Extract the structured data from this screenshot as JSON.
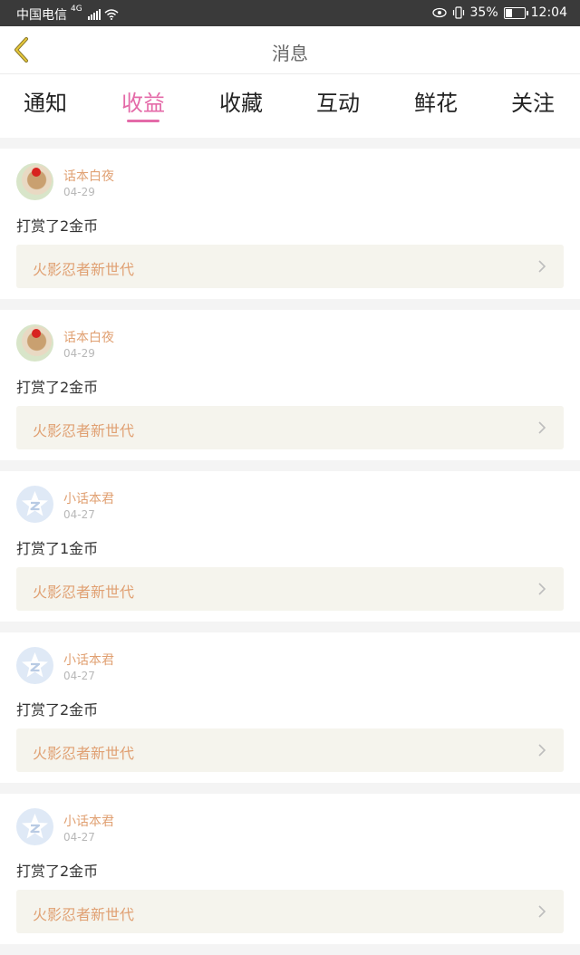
{
  "status_bar": {
    "carrier": "中国电信",
    "network": "4G",
    "battery_percent": "35%",
    "time": "12:04"
  },
  "header": {
    "title": "消息",
    "back_icon": "chevron-left-icon"
  },
  "tabs": [
    {
      "label": "通知",
      "active": false
    },
    {
      "label": "收益",
      "active": true
    },
    {
      "label": "收藏",
      "active": false
    },
    {
      "label": "互动",
      "active": false
    },
    {
      "label": "鲜花",
      "active": false
    },
    {
      "label": "关注",
      "active": false
    }
  ],
  "colors": {
    "accent": "#e46aa8",
    "username": "#e0a072",
    "link_bg": "#f5f4ed"
  },
  "feed": [
    {
      "user": "话本白夜",
      "date": "04-29",
      "message": "打赏了2金币",
      "link": "火影忍者新世代",
      "avatar": "photo"
    },
    {
      "user": "话本白夜",
      "date": "04-29",
      "message": "打赏了2金币",
      "link": "火影忍者新世代",
      "avatar": "photo"
    },
    {
      "user": "小话本君",
      "date": "04-27",
      "message": "打赏了1金币",
      "link": "火影忍者新世代",
      "avatar": "logo"
    },
    {
      "user": "小话本君",
      "date": "04-27",
      "message": "打赏了2金币",
      "link": "火影忍者新世代",
      "avatar": "logo"
    },
    {
      "user": "小话本君",
      "date": "04-27",
      "message": "打赏了2金币",
      "link": "火影忍者新世代",
      "avatar": "logo"
    }
  ]
}
